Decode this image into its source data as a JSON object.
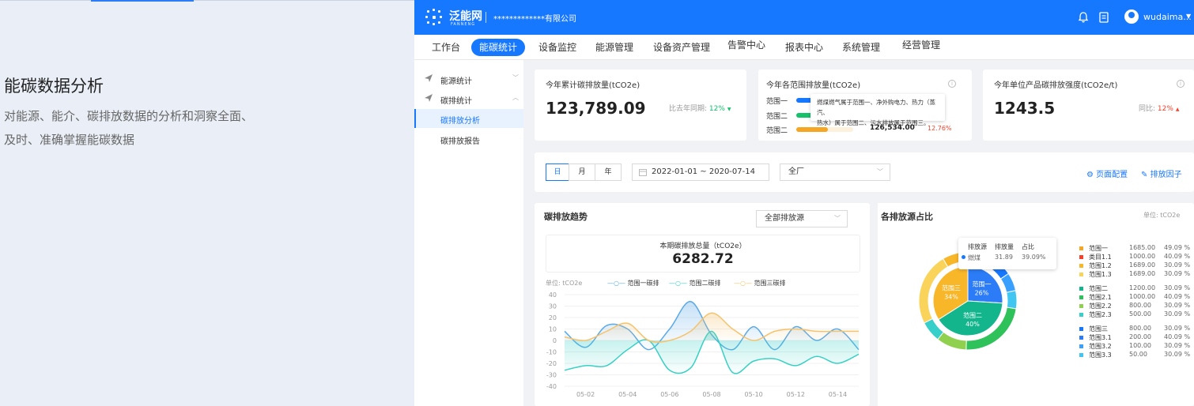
{
  "promo": {
    "title": "能碳数据分析",
    "desc_line1": "对能源、能介、碳排放数据的分析和洞察全面、",
    "desc_line2": "及时、准确掌握能碳数据"
  },
  "topbar": {
    "logo": "泛能网",
    "logo_sub": "FANNENG",
    "company": "*************有限公司",
    "user": "wudaima...",
    "icons": [
      "bell-icon",
      "document-icon",
      "user-avatar-icon",
      "caret-down-icon"
    ]
  },
  "nav": {
    "items": [
      "工作台",
      "能碳统计",
      "设备监控",
      "能源管理",
      "设备资产管理",
      "告警中心",
      "报表中心",
      "系统管理",
      "经营管理"
    ]
  },
  "sidebar": {
    "items": [
      "能源统计",
      "碳排统计",
      "碳排放分析",
      "碳排放报告"
    ]
  },
  "kpi": {
    "total": {
      "title": "今年累计碳排放量(tCO2e)",
      "value": "123,789.09",
      "compare_label": "比去年同期:",
      "compare_value": "12%",
      "compare_dir": "down"
    },
    "scope": {
      "title": "今年各范围排放量(tCO2e)",
      "rows": [
        {
          "label": "范围一",
          "color": "#1677ff",
          "fill": 0.2
        },
        {
          "label": "范围二",
          "color": "#13c26b",
          "fill": 0.2
        },
        {
          "label": "范围二",
          "color": "#f5a623",
          "fill": 0.4,
          "value": "126,534.00",
          "pct": "12.76%"
        }
      ],
      "tooltip_line1": "燃煤燃气属于范围一、净外购电力、热力（蒸汽、",
      "tooltip_line2": "热水）属于范围二、污水排放属于范围三。"
    },
    "intensity": {
      "title": "今年单位产品碳排放强度(tCO2e/t)",
      "value": "1243.5",
      "compare_label": "同比:",
      "compare_value": "12%",
      "compare_dir": "up"
    }
  },
  "filter": {
    "periods": [
      "日",
      "月",
      "年"
    ],
    "active_period": "日",
    "date_range": "2022-01-01 ~ 2020-07-14",
    "site": "全厂",
    "page_config": "页面配置",
    "emission_factor": "排放因子"
  },
  "trend": {
    "title": "碳排放趋势",
    "source_select": "全部排放源",
    "total_label": "本期碳排放总量（tCO2e）",
    "total_value": "6282.72",
    "unit": "单位: tCO2e"
  },
  "share": {
    "title": "各排放源占比",
    "unit": "单位: tCO2e",
    "tooltip": {
      "headers": [
        "排放源",
        "排放量",
        "占比"
      ],
      "row": [
        "燃煤",
        "31.89",
        "39.09%"
      ]
    },
    "center_labels": [
      {
        "name": "范围一",
        "pct": "26%"
      },
      {
        "name": "范围二",
        "pct": "40%"
      },
      {
        "name": "范围三",
        "pct": "34%"
      }
    ],
    "legend_groups": [
      [
        {
          "name": "范围一",
          "value": "1685.00",
          "pct": "49.09 %",
          "color": "#f5a623"
        },
        {
          "name": "类目1.1",
          "value": "1000.00",
          "pct": "40.09 %",
          "color": "#f5412a"
        },
        {
          "name": "范围1.2",
          "value": "1689.00",
          "pct": "30.09 %",
          "color": "#f8b629"
        },
        {
          "name": "范围1.3",
          "value": "1689.00",
          "pct": "30.09 %",
          "color": "#fad35a"
        }
      ],
      [
        {
          "name": "范围二",
          "value": "1200.00",
          "pct": "30.09 %",
          "color": "#13b58c"
        },
        {
          "name": "范围2.1",
          "value": "1000.00",
          "pct": "40.09 %",
          "color": "#2fc25b"
        },
        {
          "name": "范围2.2",
          "value": "800.00",
          "pct": "30.09 %",
          "color": "#8fd14f"
        },
        {
          "name": "范围2.3",
          "value": "500.00",
          "pct": "30.09 %",
          "color": "#36cfc9"
        }
      ],
      [
        {
          "name": "范围三",
          "value": "800.00",
          "pct": "30.09 %",
          "color": "#1677ff"
        },
        {
          "name": "范围3.1",
          "value": "200.00",
          "pct": "40.09 %",
          "color": "#2b7cf6"
        },
        {
          "name": "范围3.2",
          "value": "100.00",
          "pct": "30.09 %",
          "color": "#3aa0ff"
        },
        {
          "name": "范围3.3",
          "value": "50.00",
          "pct": "30.09 %",
          "color": "#40c6f0"
        }
      ]
    ]
  },
  "chart_data": [
    {
      "type": "line",
      "x": [
        "05-01",
        "05-02",
        "05-03",
        "05-04",
        "05-05",
        "05-06",
        "05-07",
        "05-08",
        "05-09",
        "05-10",
        "05-11",
        "05-12",
        "05-13",
        "05-14",
        "05-15"
      ],
      "xticks": [
        "05-02",
        "05-04",
        "05-06",
        "05-08",
        "05-10",
        "05-12",
        "05-14"
      ],
      "ylim": [
        -40,
        40
      ],
      "yticks": [
        40,
        30,
        20,
        10,
        0,
        -10,
        -20,
        -30,
        -40
      ],
      "series": [
        {
          "name": "范围一碳排",
          "color": "#5aa9e8",
          "values": [
            8,
            -6,
            13,
            10,
            -8,
            10,
            34,
            5,
            -8,
            12,
            -8,
            12,
            0,
            10,
            -8
          ]
        },
        {
          "name": "范围二碳排",
          "color": "#36d1c4",
          "values": [
            -26,
            -22,
            -22,
            -8,
            0,
            -26,
            -24,
            8,
            -28,
            -18,
            -16,
            -22,
            -14,
            -20,
            -12
          ]
        },
        {
          "name": "范围三碳排",
          "color": "#f6c26b",
          "values": [
            3,
            0,
            8,
            15,
            0,
            0,
            8,
            24,
            10,
            0,
            8,
            10,
            8,
            8,
            8
          ]
        }
      ]
    },
    {
      "type": "pie",
      "categories": [
        "范围一",
        "范围二",
        "范围三"
      ],
      "values": [
        26,
        40,
        34
      ]
    }
  ]
}
